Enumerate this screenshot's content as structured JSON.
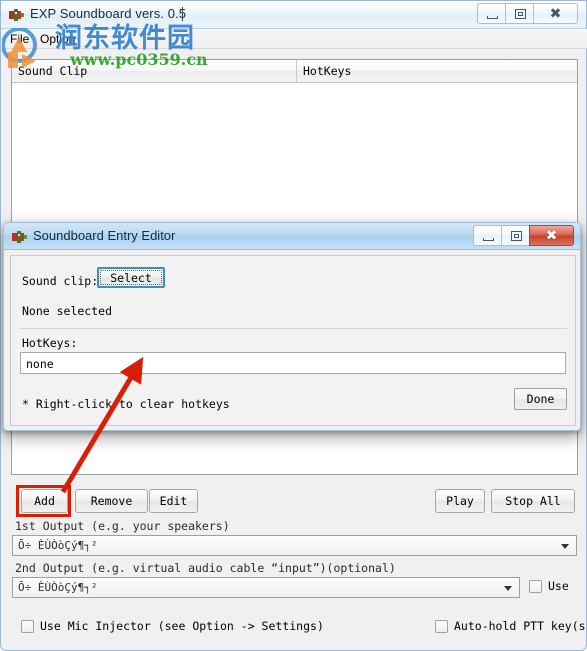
{
  "main_window": {
    "title": "EXP Soundboard vers. 0.5",
    "icon": "app-icon",
    "window_buttons": {
      "minimize": "—",
      "maximize": "□",
      "close": "✕"
    },
    "menubar": {
      "items": [
        {
          "label": "File"
        },
        {
          "label": "Option"
        }
      ]
    },
    "list": {
      "columns": [
        "Sound Clip",
        "HotKeys"
      ],
      "rows": []
    },
    "buttons": {
      "add": "Add",
      "remove": "Remove",
      "edit": "Edit",
      "play": "Play",
      "stop_all": "Stop All"
    },
    "outputs": {
      "first_label": "1st Output (e.g. your speakers)",
      "first_value": "Ō÷ ÈÙÒòÇý¶┐²",
      "second_label": "2nd Output (e.g. virtual audio cable “input”)(optional)",
      "second_value": "Ō÷ ÈÙÒòÇý¶┐²",
      "second_use_label": "Use",
      "second_use_checked": false
    },
    "footer": {
      "mic_injector_label": "Use Mic Injector (see Option -> Settings)",
      "mic_injector_checked": false,
      "auto_hold_label": "Auto-hold PTT key(s)",
      "auto_hold_checked": false
    }
  },
  "dialog": {
    "title": "Soundboard Entry Editor",
    "icon": "app-icon",
    "window_buttons": {
      "minimize": "—",
      "maximize": "□",
      "close": "✕"
    },
    "sound_clip_label": "Sound clip:",
    "select_button": "Select",
    "selection_status": "None selected",
    "hotkeys_label": "HotKeys:",
    "hotkeys_value": "none",
    "hint": "* Right-click to clear hotkeys",
    "done_button": "Done"
  },
  "annotation": {
    "arrow_color": "#d81f06",
    "highlight_color": "#e01b00",
    "highlight_target": "add-button"
  },
  "watermark": {
    "site_name_cn": "润东软件园",
    "site_url": "www.pc0359.cn",
    "cn_color": "#2f7fd0",
    "url_color": "#2aa02a"
  }
}
